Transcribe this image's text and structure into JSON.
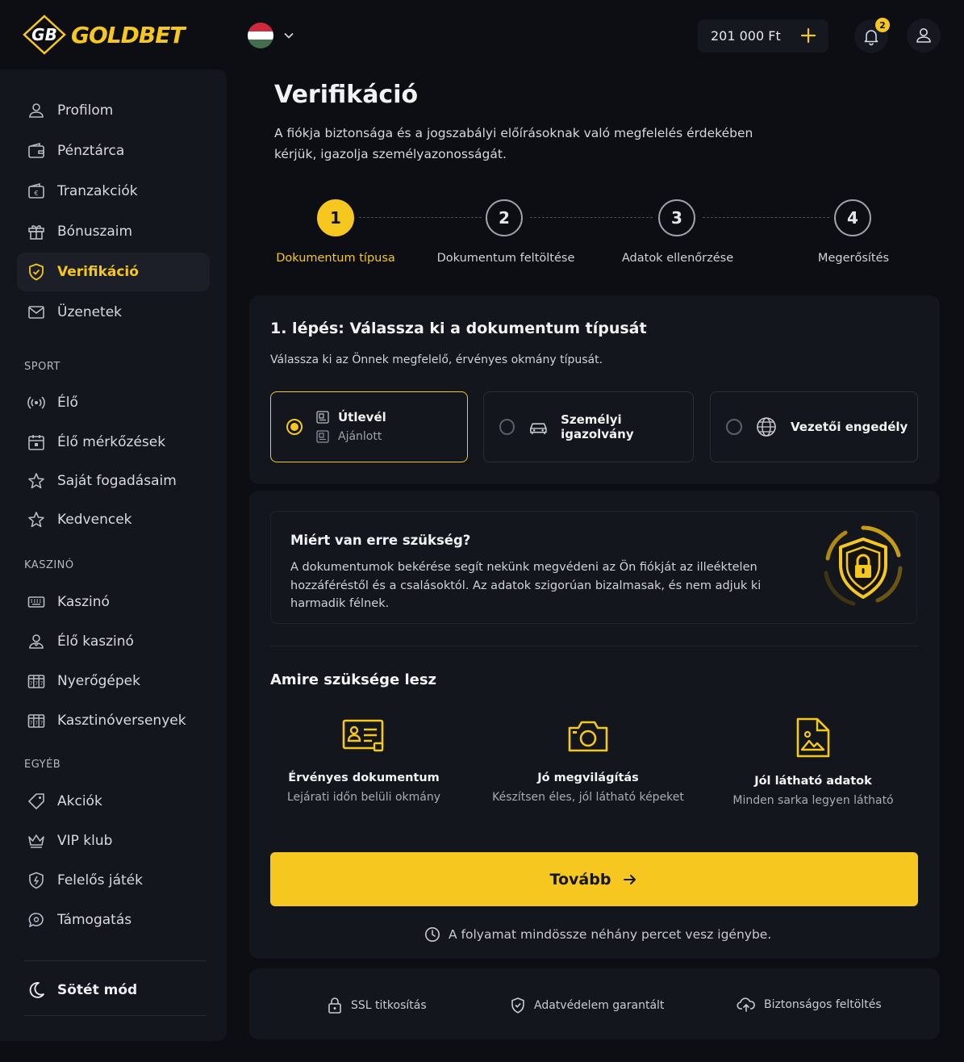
{
  "header": {
    "logo_text": "GOLDBET",
    "logo_mark": "GB",
    "balance": "201 000 Ft",
    "notifications_count": "2",
    "language_flag": "hungary-flag"
  },
  "sidebar": {
    "items": [
      {
        "label": "Profilom",
        "icon": "user-icon"
      },
      {
        "label": "Pénztárca",
        "icon": "wallet-icon"
      },
      {
        "label": "Tranzakciók",
        "icon": "transactions-icon"
      },
      {
        "label": "Bónuszaim",
        "icon": "gift-icon"
      },
      {
        "label": "Verifikáció",
        "icon": "shield-check-icon",
        "active": true
      },
      {
        "label": "Üzenetek",
        "icon": "mail-icon"
      }
    ],
    "sport_heading": "SPORT",
    "sport_items": [
      {
        "label": "Élő",
        "icon": "live-icon"
      },
      {
        "label": "Élő mérkőzések",
        "icon": "calendar-icon"
      },
      {
        "label": "Saját fogadásaim",
        "icon": "star-icon"
      },
      {
        "label": "Kedvencek",
        "icon": "star-icon"
      }
    ],
    "casino_heading": "KASZINÓ",
    "casino_items": [
      {
        "label": "Kaszinó",
        "icon": "keyboard-icon"
      },
      {
        "label": "Élő kaszinó",
        "icon": "dealer-icon"
      },
      {
        "label": "Nyerőgépek",
        "icon": "slot-icon"
      },
      {
        "label": "Kasztinóversenyek",
        "icon": "slot-icon"
      }
    ],
    "other_heading": "EGYÉB",
    "other_items": [
      {
        "label": "Akciók",
        "icon": "tag-icon"
      },
      {
        "label": "VIP klub",
        "icon": "crown-icon"
      },
      {
        "label": "Felelős játék",
        "icon": "shield-icon"
      },
      {
        "label": "Támogatás",
        "icon": "chat-icon"
      }
    ],
    "dark_mode_label": "Sötét mód"
  },
  "main": {
    "title": "Verifikáció",
    "description": "A fiókja biztonsága és a jogszabályi előírásoknak való megfelelés érdekében kérjük, igazolja személyazonosságát.",
    "steps": [
      {
        "number": "1",
        "label": "Dokumentum típusa",
        "active": true
      },
      {
        "number": "2",
        "label": "Dokumentum feltöltése"
      },
      {
        "number": "3",
        "label": "Adatok ellenőrzése"
      },
      {
        "number": "4",
        "label": "Megerősítés"
      }
    ],
    "step_title": "1. lépés: Válassza ki a dokumentum típusát",
    "step_subtitle": "Válassza ki az Önnek megfelelő, érvényes okmány típusát.",
    "document_options": [
      {
        "label": "Útlevél",
        "sublabel": "Ajánlott",
        "selected": true
      },
      {
        "label": "Személyi igazolvány",
        "selected": false
      },
      {
        "label": "Vezetői engedély",
        "selected": false
      }
    ],
    "why_title": "Miért van erre szükség?",
    "why_text": "A dokumentumok bekérése segít nekünk megvédeni az Ön fiókját az illeéktelen hozzáféréstől és a csalásoktól. Az adatok szigorúan bizalmasak, és nem adjuk ki harmadik félnek.",
    "need_title": "Amire szüksége lesz",
    "needs": [
      {
        "title": "Érvényes dokumentum",
        "subtitle": "Lejárati időn belüli okmány",
        "icon": "id-card-icon"
      },
      {
        "title": "Jó megvilágítás",
        "subtitle": "Készítsen éles, jól látható képeket",
        "icon": "camera-icon"
      },
      {
        "title": "Jól látható adatok",
        "subtitle": "Minden sarka legyen látható",
        "icon": "document-image-icon"
      }
    ],
    "next_button": "Tovább",
    "duration_note": "A folyamat mindössze néhány percet vesz igénybe.",
    "footer": [
      {
        "label": "SSL titkosítás",
        "icon": "lock-icon"
      },
      {
        "label": "Adatvédelem garantált",
        "icon": "shield-check-icon"
      },
      {
        "label": "Biztonságos feltöltés",
        "icon": "cloud-upload-icon"
      }
    ]
  },
  "colors": {
    "accent": "#f6c81f",
    "background": "#0c0e13",
    "panel": "#13161c"
  }
}
